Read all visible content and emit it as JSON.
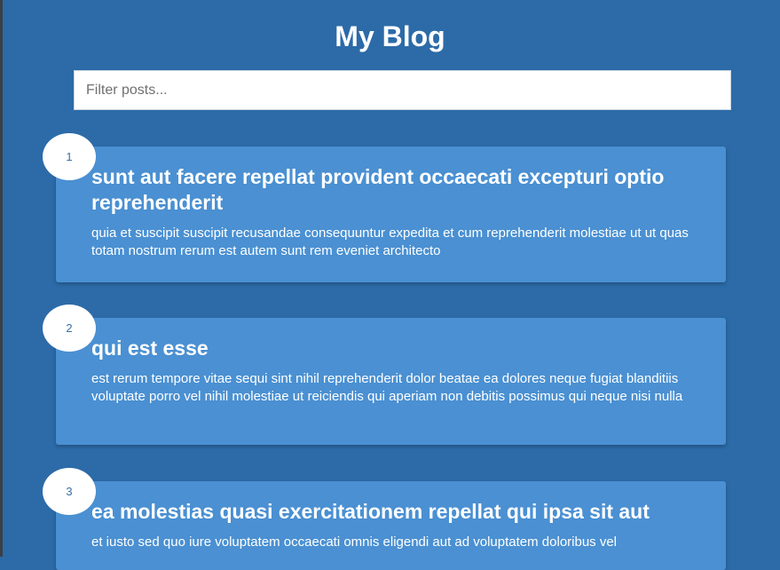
{
  "header": {
    "title": "My Blog"
  },
  "filter": {
    "placeholder": "Filter posts..."
  },
  "posts": [
    {
      "number": "1",
      "title": "sunt aut facere repellat provident occaecati excepturi optio reprehenderit",
      "body": "quia et suscipit suscipit recusandae consequuntur expedita et cum reprehenderit molestiae ut ut quas totam nostrum rerum est autem sunt rem eveniet architecto"
    },
    {
      "number": "2",
      "title": "qui est esse",
      "body": "est rerum tempore vitae sequi sint nihil reprehenderit dolor beatae ea dolores neque fugiat blanditiis voluptate porro vel nihil molestiae ut reiciendis qui aperiam non debitis possimus qui neque nisi nulla"
    },
    {
      "number": "3",
      "title": "ea molestias quasi exercitationem repellat qui ipsa sit aut",
      "body": "et iusto sed quo iure voluptatem occaecati omnis eligendi aut ad voluptatem doloribus vel"
    }
  ],
  "colors": {
    "background": "#2c6ba8",
    "card": "#4a90d2",
    "badge": "#ffffff",
    "badge_text": "#3a6fa6"
  }
}
